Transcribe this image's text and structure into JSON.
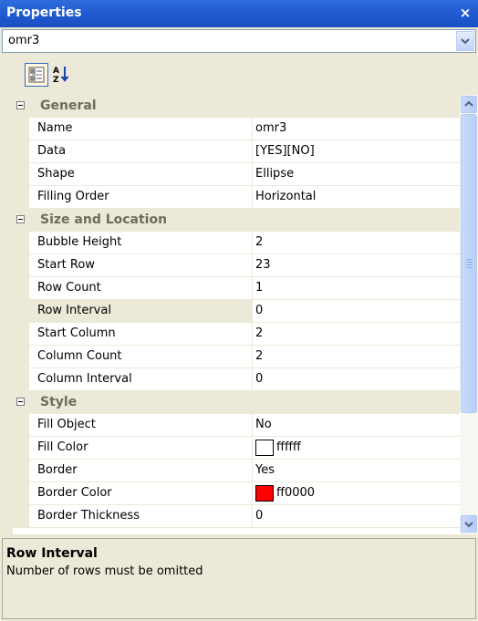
{
  "window": {
    "title": "Properties",
    "close_label": "×"
  },
  "object_selector": {
    "value": "omr3"
  },
  "toolbar": {
    "categorized_icon": "categorized-view-icon",
    "alphabetical_icon": "alphabetical-sort-icon"
  },
  "categories": [
    {
      "label": "General",
      "properties": [
        {
          "name": "Name",
          "value": "omr3"
        },
        {
          "name": "Data",
          "value": "[YES][NO]"
        },
        {
          "name": "Shape",
          "value": "Ellipse"
        },
        {
          "name": "Filling Order",
          "value": "Horizontal"
        }
      ]
    },
    {
      "label": "Size and Location",
      "properties": [
        {
          "name": "Bubble Height",
          "value": "2"
        },
        {
          "name": "Start Row",
          "value": "23"
        },
        {
          "name": "Row Count",
          "value": "1"
        },
        {
          "name": "Row Interval",
          "value": "0"
        },
        {
          "name": "Start Column",
          "value": "2"
        },
        {
          "name": "Column Count",
          "value": "2"
        },
        {
          "name": "Column Interval",
          "value": "0"
        }
      ]
    },
    {
      "label": "Style",
      "properties": [
        {
          "name": "Fill Object",
          "value": "No"
        },
        {
          "name": "Fill Color",
          "value": "ffffff",
          "swatch": "#ffffff"
        },
        {
          "name": "Border",
          "value": "Yes"
        },
        {
          "name": "Border Color",
          "value": "ff0000",
          "swatch": "#ff0000"
        },
        {
          "name": "Border Thickness",
          "value": "0"
        }
      ]
    }
  ],
  "selected_property": "Row Interval",
  "description": {
    "title": "Row Interval",
    "text": "Number of rows must be omitted"
  },
  "colors": {
    "title_bar": "#1F59CF",
    "panel_bg": "#ECE9D8",
    "category_text": "#6F6B5F"
  }
}
